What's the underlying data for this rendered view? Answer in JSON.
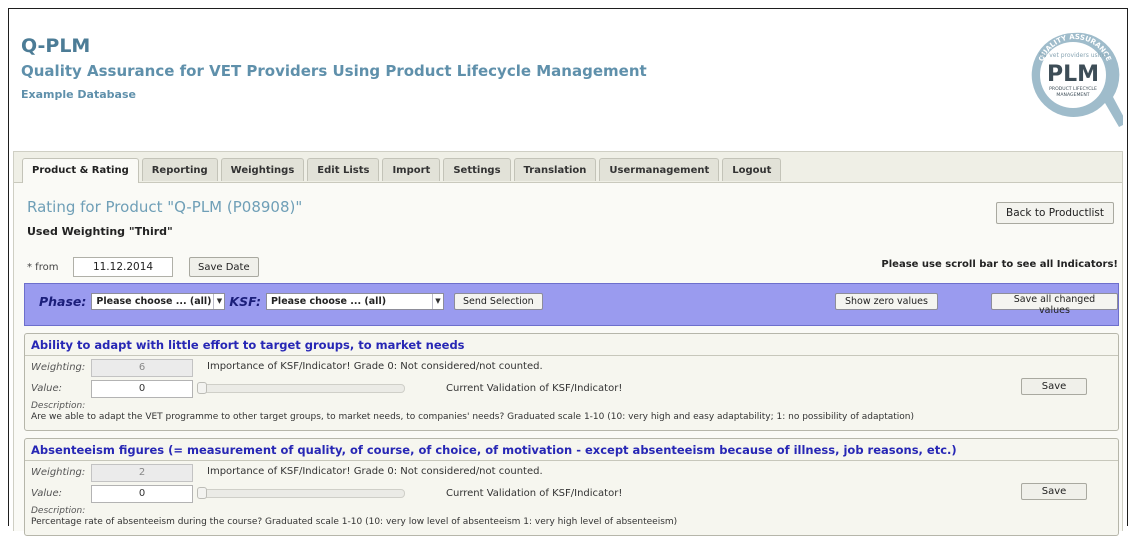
{
  "header": {
    "title": "Q-PLM",
    "subtitle": "Quality Assurance for VET Providers Using Product Lifecycle Management",
    "database": "Example Database",
    "logo": {
      "ring_text": "QUALITY ASSURANCE",
      "small_text": "for vet providers using",
      "big_text": "PLM",
      "bottom_text_1": "PRODUCT LIFECYCLE",
      "bottom_text_2": "MANAGEMENT"
    }
  },
  "tabs": [
    {
      "label": "Product & Rating",
      "active": true
    },
    {
      "label": "Reporting"
    },
    {
      "label": "Weightings"
    },
    {
      "label": "Edit Lists"
    },
    {
      "label": "Import"
    },
    {
      "label": "Settings"
    },
    {
      "label": "Translation"
    },
    {
      "label": "Usermanagement"
    },
    {
      "label": "Logout"
    }
  ],
  "rating": {
    "title": "Rating for Product \"Q-PLM (P08908)\"",
    "weighting_used": "Used Weighting \"Third\"",
    "back_label": "Back to Productlist",
    "from_label": "* from",
    "date": "11.12.2014",
    "save_date_label": "Save Date",
    "scroll_hint": "Please use scroll bar to see all Indicators!"
  },
  "filter": {
    "phase_label": "Phase:",
    "phase_value": "Please choose ... (all)",
    "ksf_label": "KSF:",
    "ksf_value": "Please choose ... (all)",
    "send_label": "Send Selection",
    "zero_label": "Show zero values",
    "save_all_label": "Save all changed values"
  },
  "labels": {
    "weighting": "Weighting:",
    "value": "Value:",
    "description": "Description:",
    "importance": "Importance of KSF/Indicator! Grade 0: Not considered/not counted.",
    "validation": "Current Validation of KSF/Indicator!",
    "save": "Save"
  },
  "indicators": [
    {
      "title": "Ability to adapt with little effort to target groups, to market needs",
      "weighting": "6",
      "value": "0",
      "level": 0,
      "description": "Are we able to adapt the VET programme to other target groups, to market needs, to companies' needs? Graduated scale 1-10 (10: very high and easy adaptability; 1: no possibility of adaptation)"
    },
    {
      "title": "Absenteeism figures (= measurement of quality, of course, of choice, of motivation - except absenteeism because of illness, job reasons, etc.)",
      "weighting": "2",
      "value": "0",
      "level": 0,
      "description": "Percentage rate of absenteeism during the course? Graduated scale 1-10 (10: very low level of absenteeism 1: very high level of absenteeism)"
    }
  ],
  "colors": {
    "title": "#4c7c96",
    "filter_bg": "#9a9bef",
    "indicator_title": "#2727b5"
  }
}
